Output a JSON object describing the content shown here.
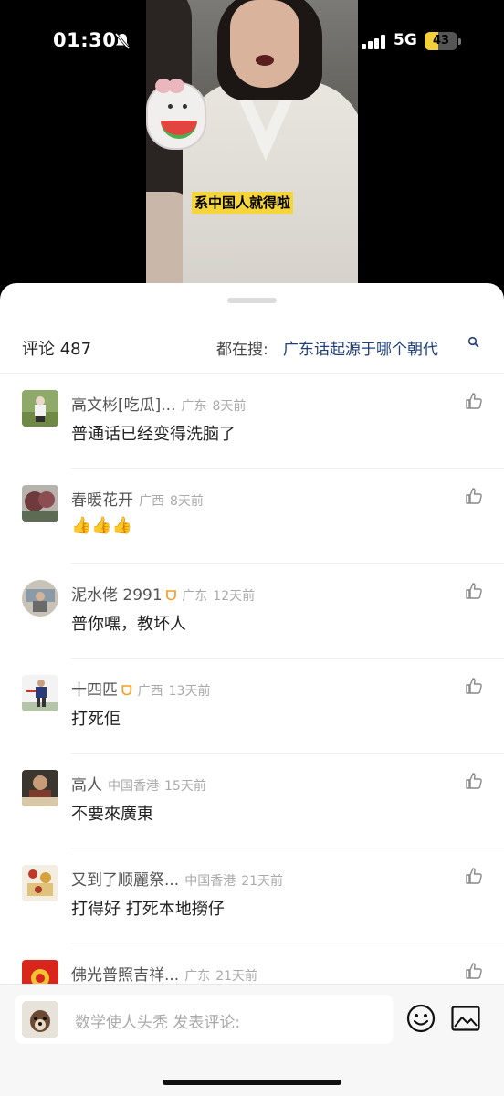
{
  "status_bar": {
    "time": "01:30",
    "network": "5G",
    "battery_level": "43",
    "battery_fraction": 0.43
  },
  "video": {
    "subtitle": "系中国人就得啦"
  },
  "comments_panel": {
    "title": "评论 487",
    "search_prefix": "都在搜:",
    "search_term": "广东话起源于哪个朝代",
    "comments": [
      {
        "name": "高文彬[吃瓜]...",
        "location": "广东",
        "time": "8天前",
        "text": "普通话已经变得洗脑了",
        "badge": ""
      },
      {
        "name": "春暖花开",
        "location": "广西",
        "time": "8天前",
        "text": "👍👍👍",
        "badge": ""
      },
      {
        "name": "泥水佬 2991",
        "location": "广东",
        "time": "12天前",
        "text": "普你嘿，教坏人",
        "badge": "ᗜ"
      },
      {
        "name": "十四匹",
        "location": "广西",
        "time": "13天前",
        "text": "打死佢",
        "badge": "ᗜ"
      },
      {
        "name": "高人",
        "location": "中国香港",
        "time": "15天前",
        "text": "不要來廣東",
        "badge": ""
      },
      {
        "name": "又到了顺麗祭...",
        "location": "中国香港",
        "time": "21天前",
        "text": "打得好 打死本地撈仔",
        "badge": ""
      },
      {
        "name": "佛光普照吉祥...",
        "location": "广东",
        "time": "21天前",
        "text": "",
        "badge": ""
      }
    ]
  },
  "input_bar": {
    "placeholder": "数学使人头秃 发表评论:"
  },
  "icons": {
    "like": "thumbs-up-icon",
    "emoji": "smiley-icon",
    "image": "image-icon",
    "search": "search-icon",
    "silent": "bell-off-icon"
  },
  "colors": {
    "accent_link": "#1f3e7a",
    "subtitle_bg": "#f5d53a",
    "battery": "#f4d13b",
    "badge": "#f0a22a"
  }
}
